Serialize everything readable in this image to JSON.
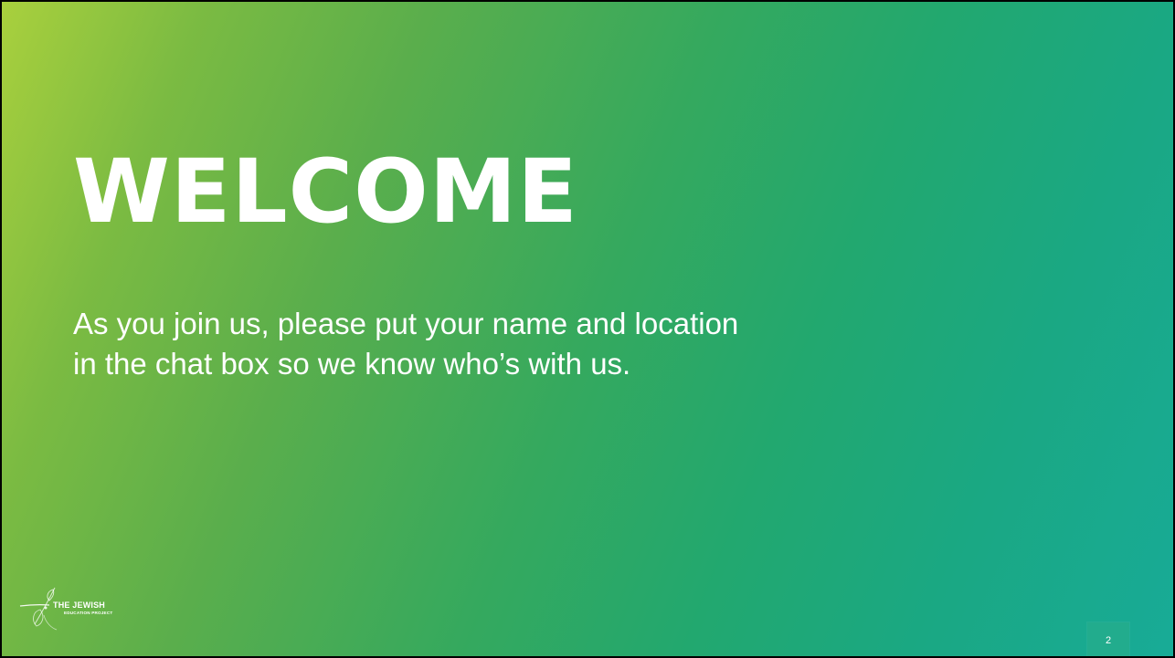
{
  "slide": {
    "title": "WELCOME",
    "body": "As you join us, please put your name and location in the chat box so we know who’s with us.",
    "page_number": "2",
    "colors": {
      "gradient_start": "#a9d03d",
      "gradient_mid": "#35a95e",
      "gradient_end": "#18ab97",
      "text": "#ffffff"
    }
  },
  "logo": {
    "line1": "THE JEWISH",
    "line2": "EDUCATION PROJECT",
    "icon": "leaf-swirl-logo-icon"
  }
}
